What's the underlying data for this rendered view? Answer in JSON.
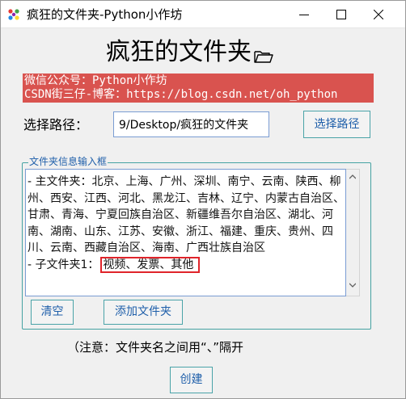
{
  "window": {
    "title": "疯狂的文件夹-Python小作坊"
  },
  "header": {
    "title": "疯狂的文件夹",
    "title_icon": "folder-icon"
  },
  "banner": {
    "line1": "微信公众号：Python小作坊",
    "line2": "CSDN街三仔-博客：https://blog.csdn.net/oh_python",
    "background": "#d9534f"
  },
  "path": {
    "label": "选择路径：",
    "value": "9/Desktop/疯狂的文件夹",
    "choose_button": "选择路径"
  },
  "group": {
    "label": "文件夹信息输入框",
    "main_folders": "- 主文件夹：北京、上海、广州、深圳、南宁、云南、陕西、柳州、西安、江西、河北、黑龙江、吉林、辽宁、内蒙古自治区、甘肃、青海、宁夏回族自治区、新疆维吾尔自治区、湖北、河南、湖南、山东、江苏、安徽、浙江、福建、重庆、贵州、四川、云南、西藏自治区、海南、广西壮族自治区",
    "sub_label": "- 子文件夹1：",
    "sub_value": "视频、发票、其他",
    "clear_button": "清空",
    "add_button": "添加文件夹"
  },
  "note": "（注意：文件夹名之间用“、”隔开",
  "create_button": "创建",
  "colors": {
    "accent_border": "#45a2a2",
    "button_text": "#1f5faa",
    "highlight": "#e0242a"
  }
}
